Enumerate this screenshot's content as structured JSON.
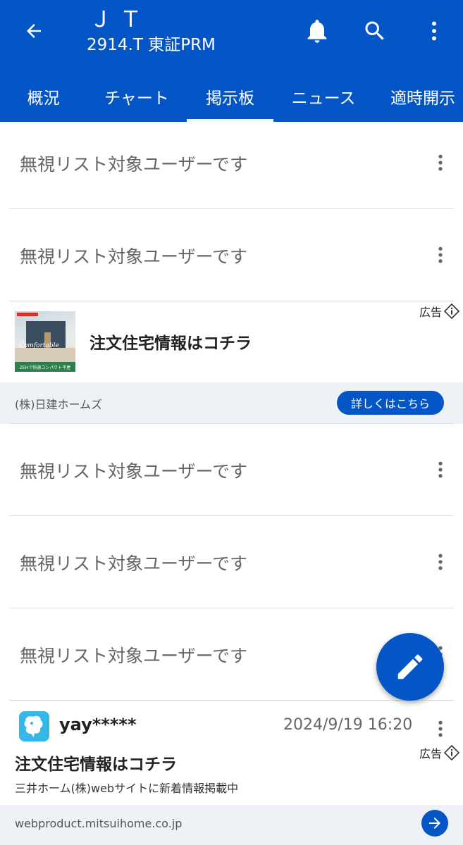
{
  "header": {
    "title": "ＪＴ",
    "subtitle": "2914.T 東証PRM",
    "background_color": "#0456c7",
    "icons": [
      "back-arrow-icon",
      "bell-icon",
      "search-icon",
      "more-vert-icon"
    ]
  },
  "tabs": [
    {
      "label": "概況",
      "active": false
    },
    {
      "label": "チャート",
      "active": false
    },
    {
      "label": "掲示板",
      "active": true
    },
    {
      "label": "ニュース",
      "active": false
    },
    {
      "label": "適時開示",
      "active": false
    }
  ],
  "ignored_text": "無視リスト対象ユーザーです",
  "ad1": {
    "label": "広告",
    "headline": "注文住宅情報はコチラ",
    "thumb_text": "Comfortable",
    "thumb_band": "ZEHで快適コンパクト平屋",
    "advertiser": "(株)日建ホームズ",
    "cta": "詳しくはこちら"
  },
  "post": {
    "username": "yay*****",
    "timestamp": "2024/9/19 16:20"
  },
  "ad2": {
    "label": "広告",
    "headline": "注文住宅情報はコチラ",
    "description": "三井ホーム(株)webサイトに新着情報掲載中",
    "url": "webproduct.mitsuihome.co.jp"
  },
  "fab": {
    "icon": "pencil-icon"
  },
  "colors": {
    "accent": "#0456c7",
    "ad_footer_bg": "#eef2f7",
    "divider": "#dcdcdc"
  }
}
